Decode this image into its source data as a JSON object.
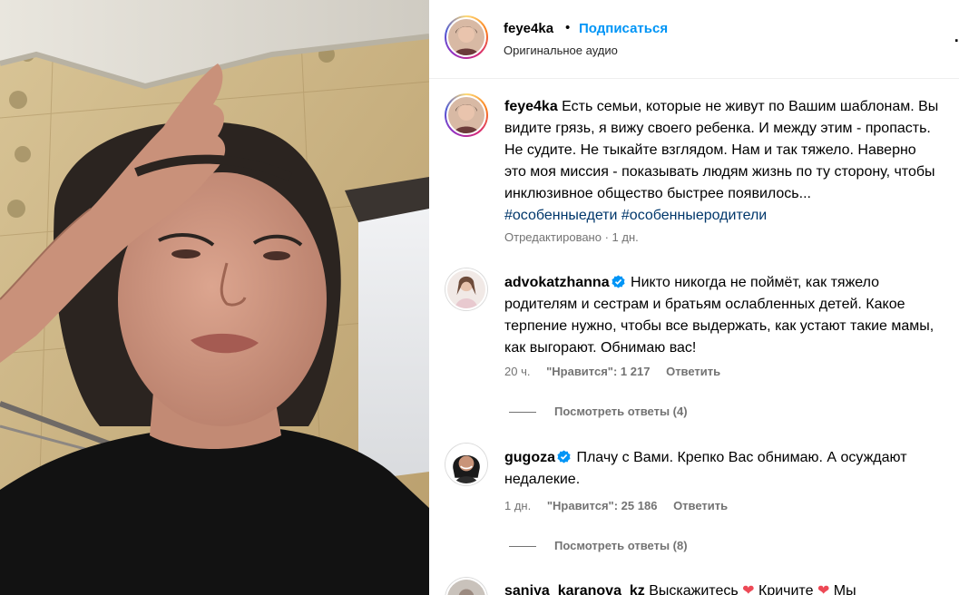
{
  "post": {
    "username": "feye4ka",
    "separator": "•",
    "follow_label": "Подписаться",
    "audio_label": "Оригинальное аудио",
    "more_label": "…"
  },
  "caption": {
    "username": "feye4ka",
    "text": "Есть семьи, которые не живут по Вашим шаблонам. Вы видите грязь, я вижу своего ребенка. И между этим - пропасть. Не судите. Не тыкайте взглядом. Нам и так тяжело. Наверно это моя миссия - показывать людям жизнь по ту сторону, чтобы инклюзивное общество быстрее появилось...",
    "hashtag1": "#особенныедети",
    "hashtag2": "#особенныеродители",
    "edited": "Отредактировано · 1 дн."
  },
  "comments": [
    {
      "username": "advokatzhanna",
      "text": "Никто никогда не поймёт, как тяжело родителям и сестрам и братьям ослабленных детей. Какое терпение нужно, чтобы все выдержать, как устают такие мамы, как выгорают. Обнимаю вас!",
      "time": "20 ч.",
      "likes": "\"Нравится\": 1 217",
      "reply": "Ответить",
      "view_replies": "Посмотреть ответы (4)"
    },
    {
      "username": "gugoza",
      "text": "Плачу с Вами. Крепко Вас обнимаю. А осуждают недалекие.",
      "time": "1 дн.",
      "likes": "\"Нравится\": 25 186",
      "reply": "Ответить",
      "view_replies": "Посмотреть ответы (8)"
    },
    {
      "username": "saniya_karanova_kz",
      "text_a": "Выскажитесь",
      "text_b": "Кричите",
      "text_c": "Мы"
    }
  ],
  "colors": {
    "link_blue": "#0095f6",
    "hashtag": "#00376b",
    "meta_gray": "#737373",
    "verified": "#0095f6"
  },
  "icons": [
    "verified-badge-icon",
    "more-options-icon",
    "heart-icon"
  ]
}
